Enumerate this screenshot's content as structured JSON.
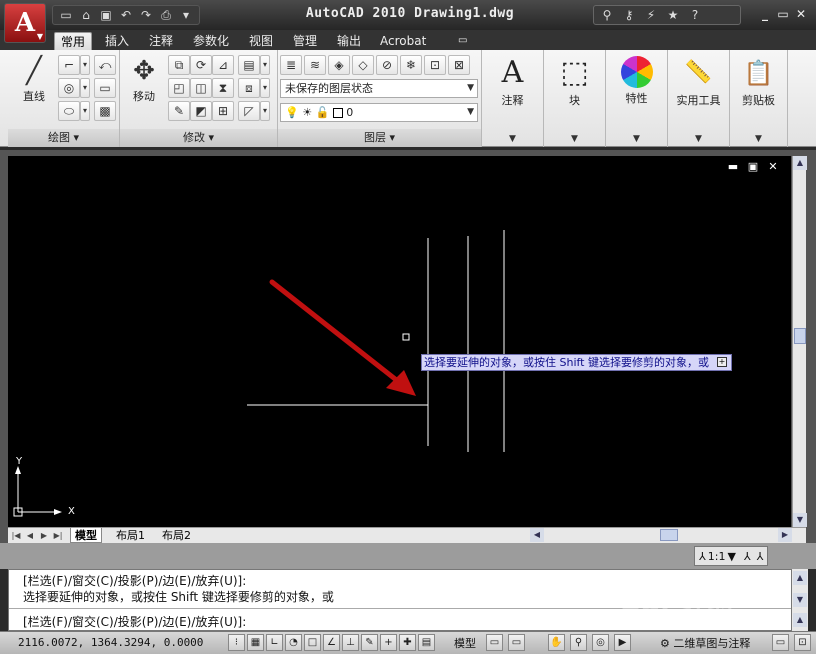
{
  "app": {
    "title": "AutoCAD 2010  Drawing1.dwg",
    "logo_letter": "A"
  },
  "quick_access": [
    "new-icon",
    "open-icon",
    "save-icon",
    "undo-icon",
    "redo-icon",
    "plot-icon"
  ],
  "infocenter": [
    "binoculars-icon",
    "key-icon",
    "satellite-icon",
    "star-icon",
    "help-icon"
  ],
  "window_buttons": {
    "minimize": "_",
    "restore": "▭",
    "close": "✕"
  },
  "ribbon_tabs": [
    {
      "label": "常用",
      "active": true
    },
    {
      "label": "插入"
    },
    {
      "label": "注释"
    },
    {
      "label": "参数化"
    },
    {
      "label": "视图"
    },
    {
      "label": "管理"
    },
    {
      "label": "输出"
    },
    {
      "label": "Acrobat"
    }
  ],
  "ribbon": {
    "draw_panel": {
      "title": "绘图 ▾",
      "line_label": "直线"
    },
    "modify_panel": {
      "title": "修改 ▾",
      "move_label": "移动"
    },
    "layers_panel": {
      "title": "图层 ▾",
      "layer_state": "未保存的图层状态",
      "current_layer": "0"
    },
    "annotation": {
      "label": "注释"
    },
    "block": {
      "label": "块"
    },
    "properties": {
      "label": "特性"
    },
    "utilities": {
      "label": "实用工具"
    },
    "clipboard": {
      "label": "剪贴板"
    }
  },
  "canvas": {
    "prompt_tip": "选择要延伸的对象，或按住 Shift 键选择要修剪的对象，或",
    "ucs": {
      "y_label": "Y",
      "x_label": "X"
    },
    "viewport_controls": {
      "minimize": "▬",
      "restore": "▣",
      "close": "✕"
    }
  },
  "layout_tabs": [
    {
      "label": "模型",
      "active": true
    },
    {
      "label": "布局1"
    },
    {
      "label": "布局2"
    }
  ],
  "annotation_scale": "1:1",
  "command_window": {
    "lines": [
      "[栏选(F)/窗交(C)/投影(P)/边(E)/放弃(U)]:",
      "选择要延伸的对象，或按住 Shift 键选择要修剪的对象，或",
      "[栏选(F)/窗交(C)/投影(P)/边(E)/放弃(U)]:"
    ]
  },
  "status_bar": {
    "coordinates": "2116.0072, 1364.3294, 0.0000",
    "model_label": "模型",
    "workspace": "二维草图与注释"
  },
  "watermark": {
    "main": "Bai 经验",
    "sub": "jingyan.baidu.com"
  },
  "colors": {
    "accent_red": "#b01818",
    "tip_bg": "#d6d6f8"
  }
}
